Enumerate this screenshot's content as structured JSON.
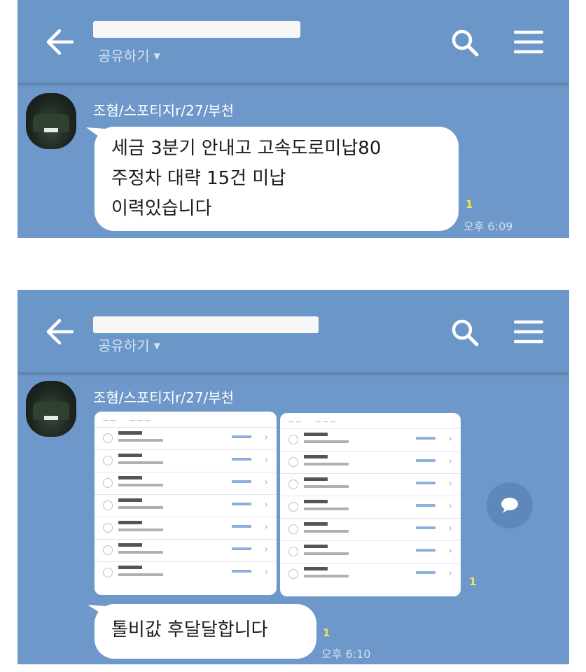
{
  "panels": [
    {
      "header": {
        "subtitle": "공유하기"
      },
      "sender": "조혐/스포티지r/27/부천",
      "message": "세금 3분기 안내고  고속도로미납80\n주정차 대략 15건 미납\n이력있습니다",
      "unread": "1",
      "time": "오후 6:09"
    },
    {
      "header": {
        "subtitle": "공유하기"
      },
      "sender": "조혐/스포티지r/27/부천",
      "image_unread": "1",
      "message": "톨비값 후달달합니다",
      "unread": "1",
      "time": "오후 6:10"
    }
  ],
  "icons": {
    "back": "arrow-left-icon",
    "search": "search-icon",
    "menu": "hamburger-menu-icon",
    "share": "speech-bubble-icon",
    "caret": "caret-down-icon"
  },
  "colors": {
    "chat_background": "#6d98c9",
    "header": "#6a96c8",
    "bubble": "#ffffff",
    "unread": "#f1e65a"
  }
}
